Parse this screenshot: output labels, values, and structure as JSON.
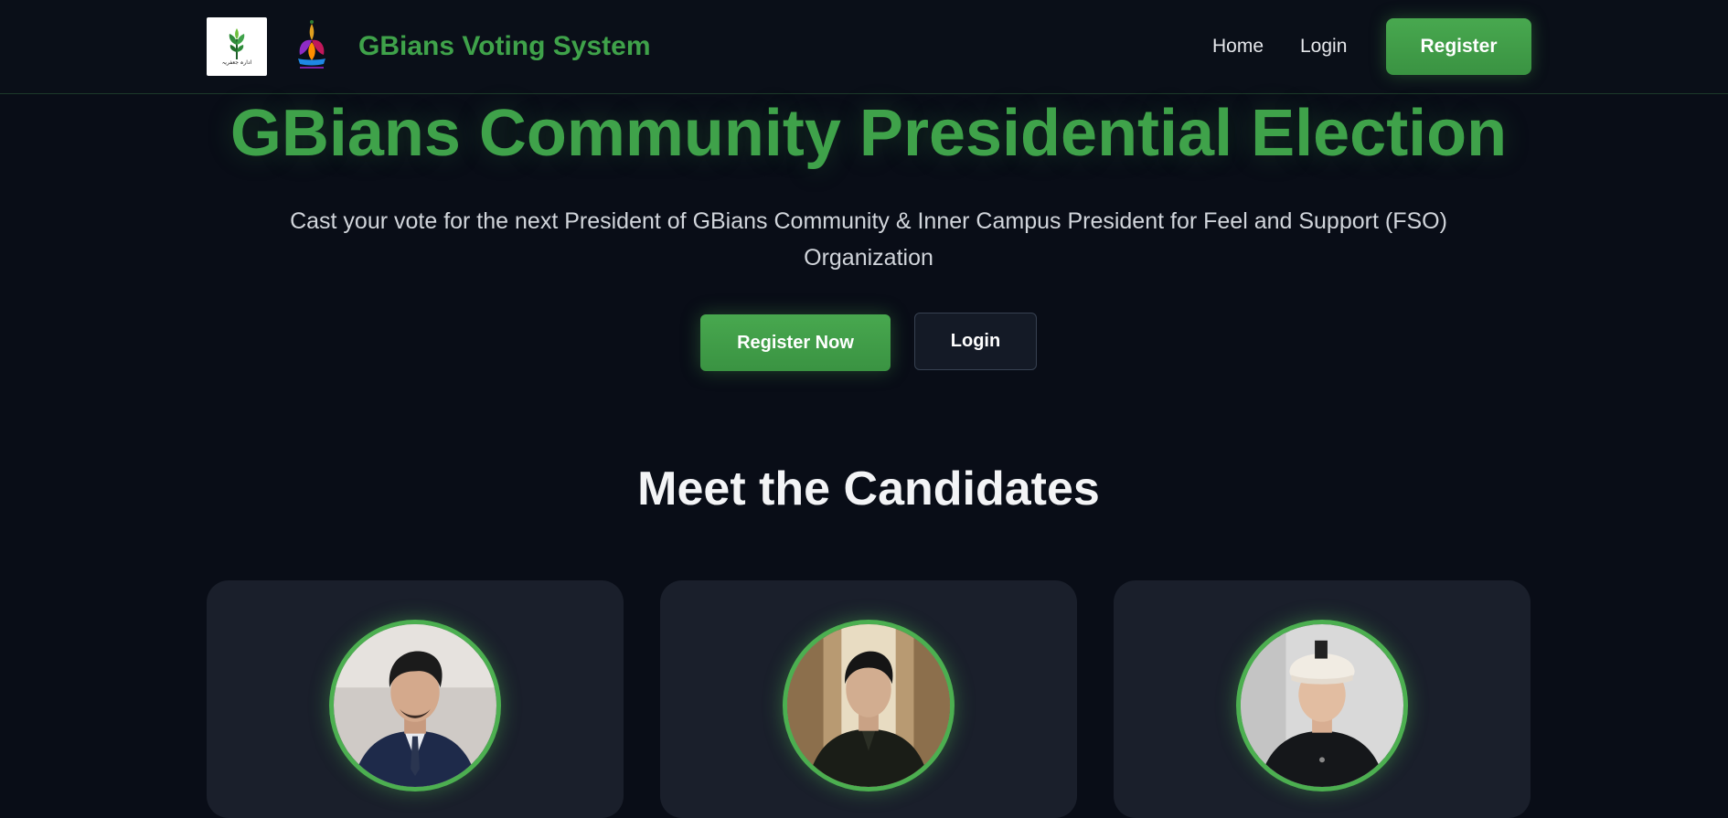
{
  "navbar": {
    "logo1_text": "ادارہ جعفریہ",
    "brand": "GBians Voting System",
    "links": [
      {
        "label": "Home"
      },
      {
        "label": "Login"
      }
    ],
    "register_label": "Register"
  },
  "hero": {
    "title": "GBians Community Presidential Election",
    "subtitle": "Cast your vote for the next President of GBians Community & Inner Campus President for Feel and Support (FSO) Organization",
    "register_now_label": "Register Now",
    "login_label": "Login"
  },
  "candidates_section": {
    "title": "Meet the Candidates"
  },
  "colors": {
    "accent": "#3fa24a",
    "background": "#090d17",
    "card": "#1a1f2b"
  }
}
